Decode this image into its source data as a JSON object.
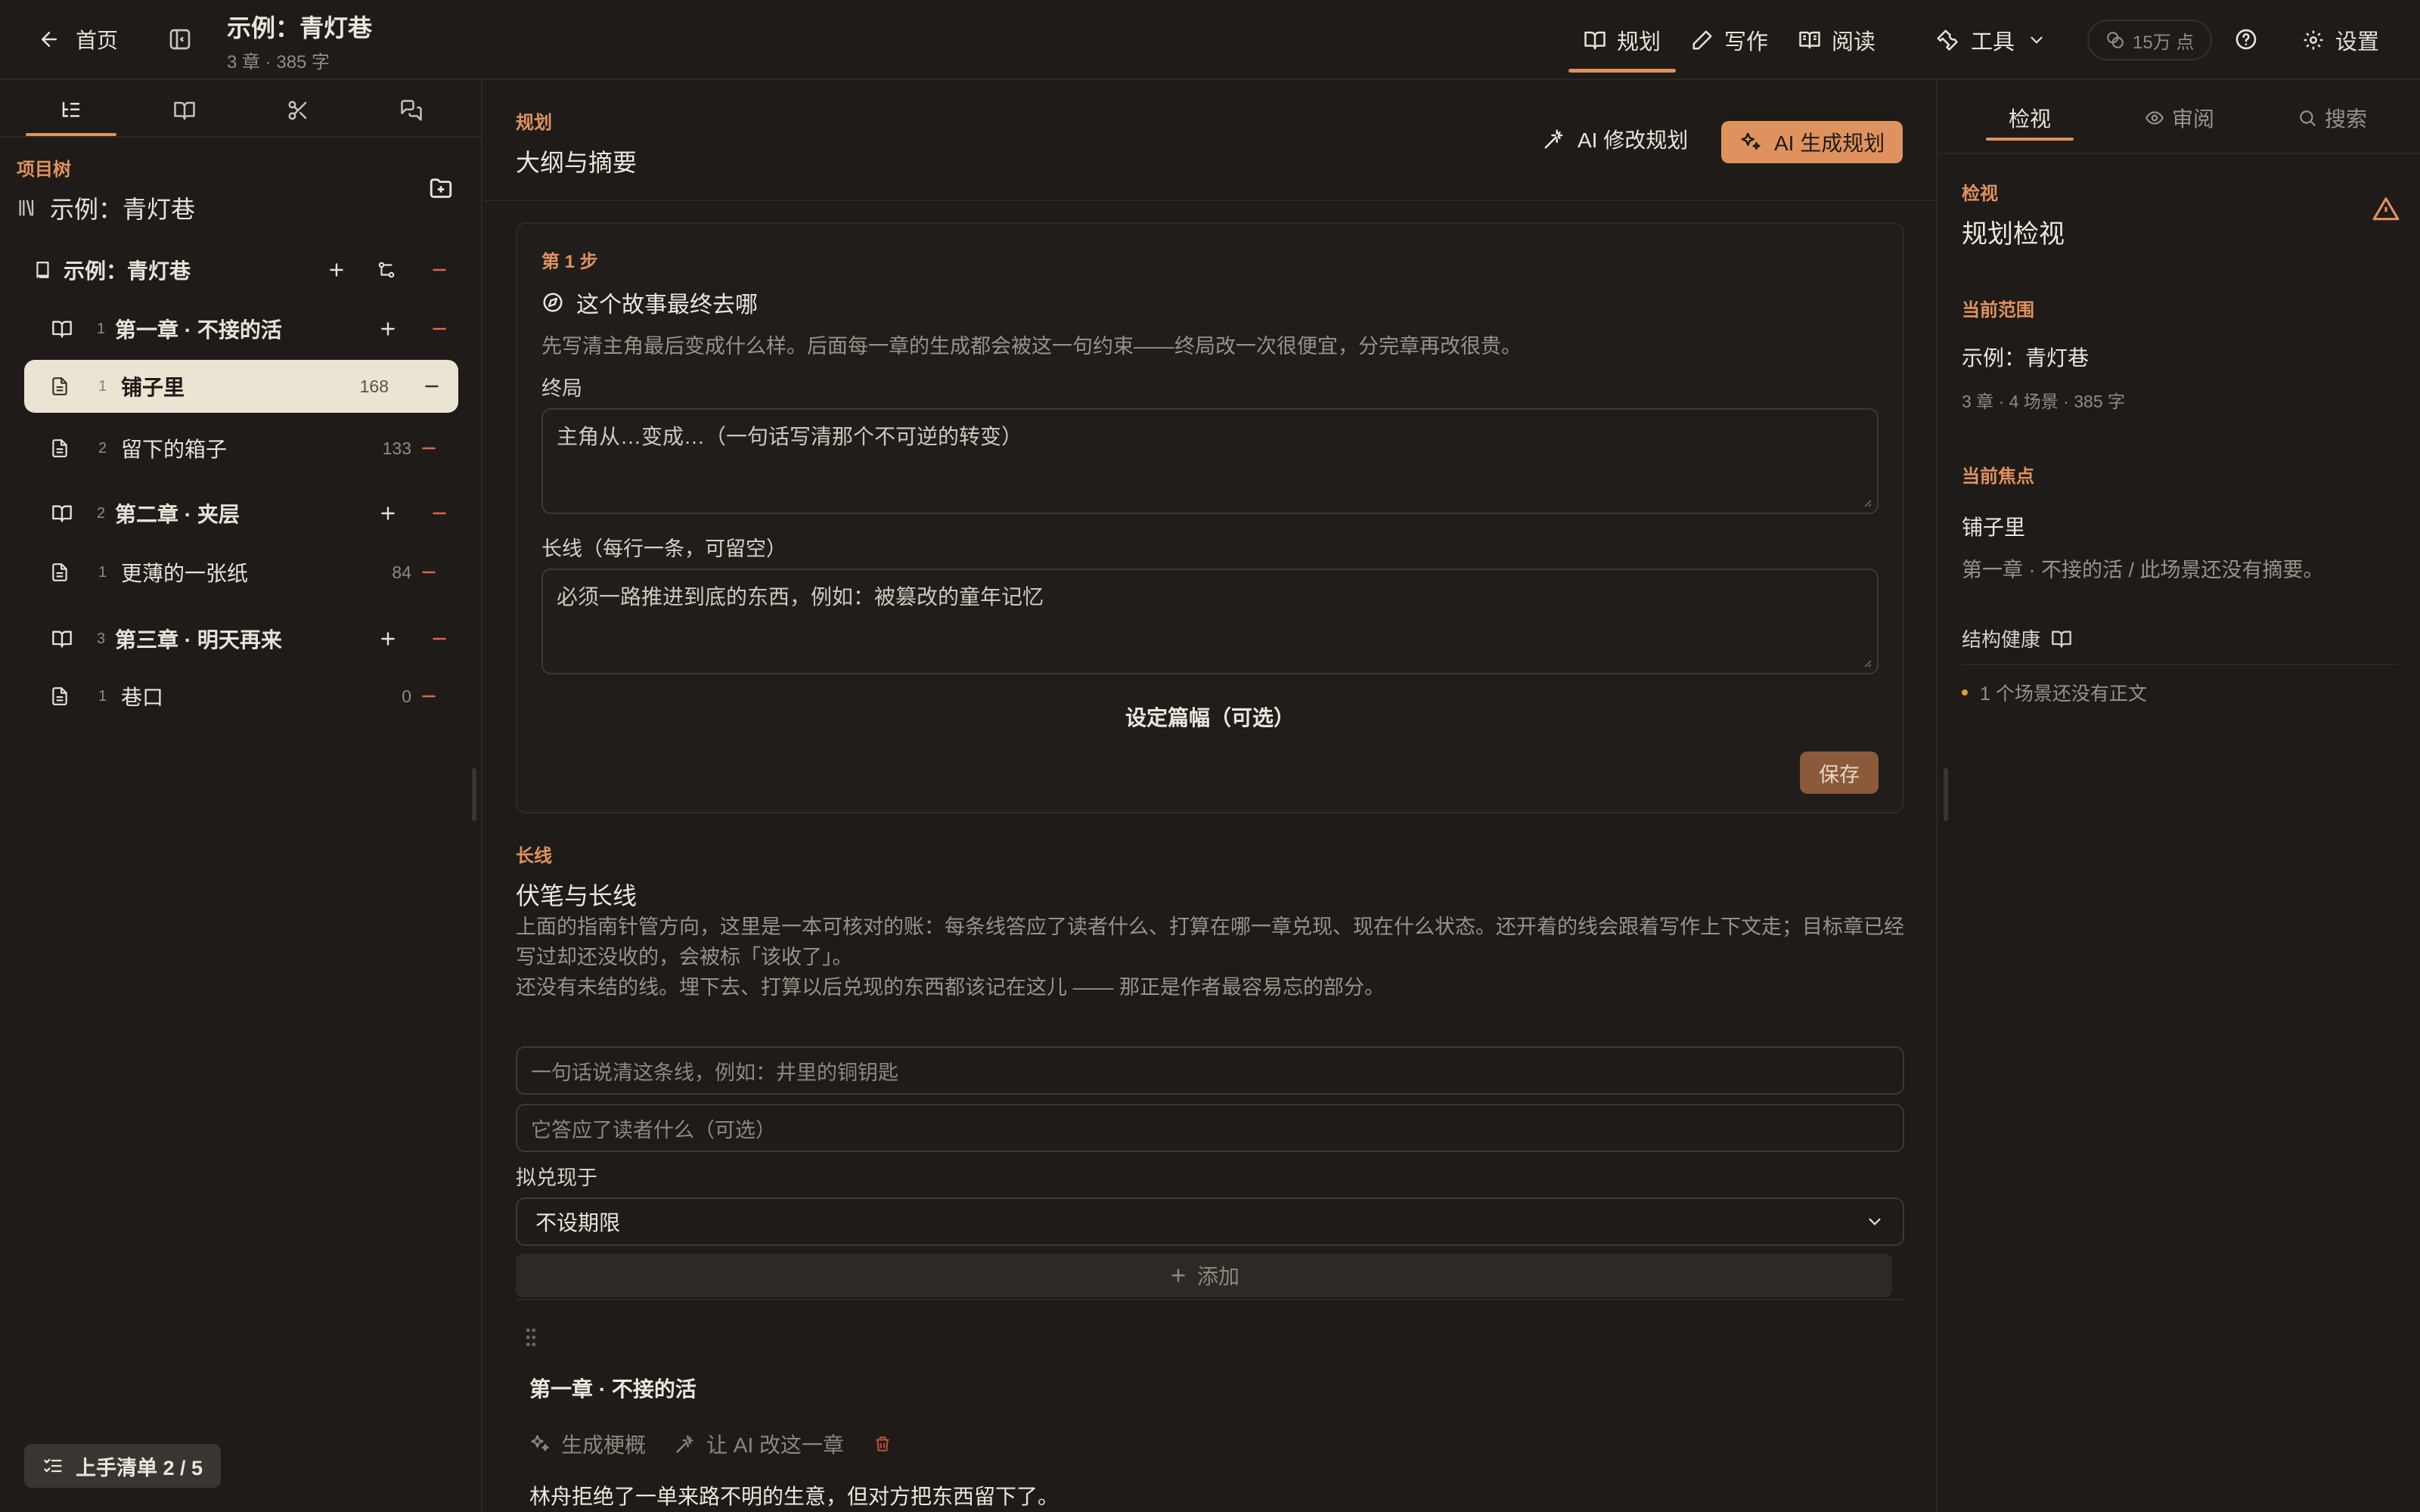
{
  "topbar": {
    "back_label": "首页",
    "project_title": "示例：青灯巷",
    "project_meta": "3 章 · 385 字",
    "modes": [
      {
        "label": "规划",
        "icon": "book-open-icon",
        "active": true
      },
      {
        "label": "写作",
        "icon": "pen-icon",
        "active": false
      },
      {
        "label": "阅读",
        "icon": "reader-icon",
        "active": false
      }
    ],
    "tools_label": "工具",
    "points_label": "15万 点",
    "settings_label": "设置"
  },
  "sidebar": {
    "section_label": "项目树",
    "root_title": "示例：青灯巷",
    "book": {
      "label": "示例：青灯巷"
    },
    "chapters": [
      {
        "num": "1",
        "label": "第一章 · 不接的活",
        "scenes": [
          {
            "num": "1",
            "label": "铺子里",
            "count": "168",
            "selected": true
          },
          {
            "num": "2",
            "label": "留下的箱子",
            "count": "133",
            "selected": false
          }
        ]
      },
      {
        "num": "2",
        "label": "第二章 · 夹层",
        "scenes": [
          {
            "num": "1",
            "label": "更薄的一张纸",
            "count": "84",
            "selected": false
          }
        ]
      },
      {
        "num": "3",
        "label": "第三章 · 明天再来",
        "scenes": [
          {
            "num": "1",
            "label": "巷口",
            "count": "0",
            "selected": false
          }
        ]
      }
    ],
    "checklist_label": "上手清单 2 / 5"
  },
  "main": {
    "section_tag": "规划",
    "section_title": "大纲与摘要",
    "ai_modify_label": "AI 修改规划",
    "ai_generate_label": "AI 生成规划",
    "step": {
      "tag": "第 1 步",
      "question": "这个故事最终去哪",
      "description": "先写清主角最后变成什么样。后面每一章的生成都会被这一句约束——终局改一次很便宜，分完章再改很贵。",
      "ending_label": "终局",
      "ending_placeholder": "主角从…变成…（一句话写清那个不可逆的转变）",
      "threads_label": "长线（每行一条，可留空）",
      "threads_placeholder": "必须一路推进到底的东西，例如：被篡改的童年记忆",
      "length_label": "设定篇幅（可选）",
      "save_label": "保存"
    },
    "threads": {
      "tag": "长线",
      "title": "伏笔与长线",
      "desc_1": "上面的指南针管方向，这里是一本可核对的账：每条线答应了读者什么、打算在哪一章兑现、现在什么状态。还开着的线会跟着写作上下文走；目标章已经写过却还没收的，会被标「该收了」。",
      "desc_2": "还没有未结的线。埋下去、打算以后兑现的东西都该记在这儿 —— 那正是作者最容易忘的部分。",
      "line_placeholder": "一句话说清这条线，例如：井里的铜钥匙",
      "promise_placeholder": "它答应了读者什么（可选）",
      "due_label": "拟兑现于",
      "due_value": "不设期限",
      "add_label": "添加"
    },
    "chapter_block": {
      "title": "第一章 · 不接的活",
      "generate_label": "生成梗概",
      "ai_rewrite_label": "让 AI 改这一章",
      "summary": "林舟拒绝了一单来路不明的生意，但对方把东西留下了。"
    }
  },
  "inspector": {
    "tabs": [
      {
        "label": "检视",
        "active": true
      },
      {
        "label": "审阅",
        "active": false
      },
      {
        "label": "搜索",
        "active": false
      }
    ],
    "tag": "检视",
    "title": "规划检视",
    "scope_label": "当前范围",
    "scope_value": "示例：青灯巷",
    "scope_meta": "3 章 · 4 场景 · 385 字",
    "focus_label": "当前焦点",
    "focus_value": "铺子里",
    "focus_desc": "第一章 · 不接的活 / 此场景还没有摘要。",
    "health_label": "结构健康",
    "health_item": "1 个场景还没有正文"
  },
  "colors": {
    "background": "#1e1b18",
    "accent": "#e0925e",
    "selected_row": "#ece4d2",
    "warning_dot": "#d8a23a"
  }
}
